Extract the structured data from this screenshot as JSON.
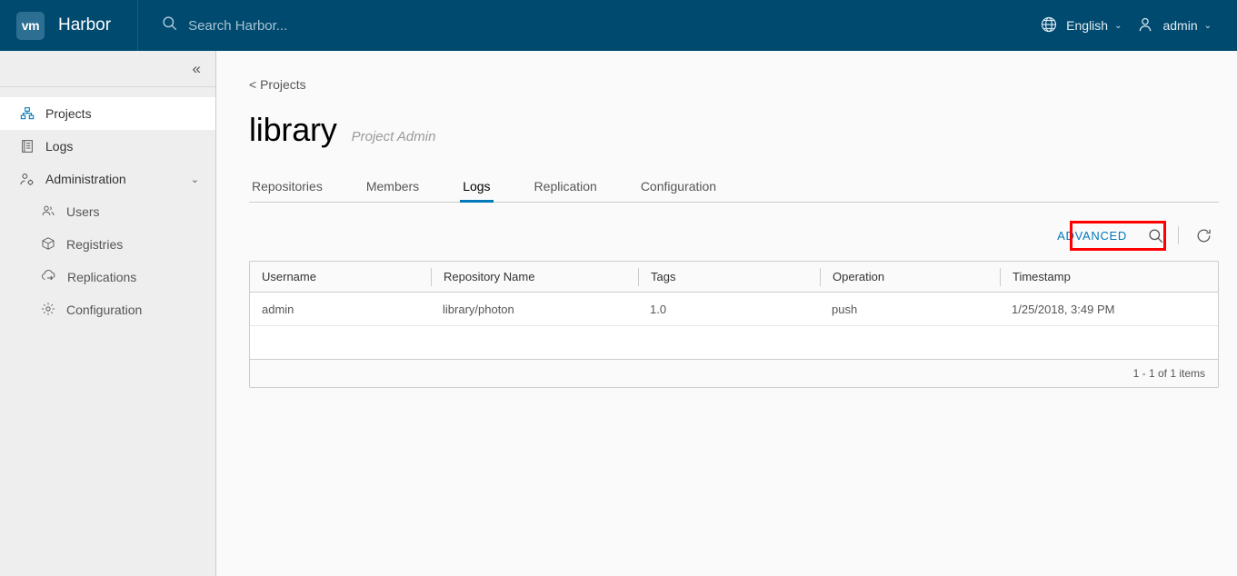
{
  "header": {
    "logo_text": "vm",
    "brand": "Harbor",
    "search": {
      "placeholder": "Search Harbor...",
      "value": "",
      "icon": "search-icon"
    },
    "language": {
      "label": "English",
      "icon": "globe-icon",
      "caret": "⌄"
    },
    "user": {
      "label": "admin",
      "icon": "user-icon",
      "caret": "⌄"
    }
  },
  "sidebar": {
    "collapse_icon": "«",
    "items": [
      {
        "label": "Projects",
        "icon": "projects-icon",
        "active": true
      },
      {
        "label": "Logs",
        "icon": "logs-icon",
        "active": false
      },
      {
        "label": "Administration",
        "icon": "administration-icon",
        "active": false,
        "chevron": "⌄"
      }
    ],
    "sub_items": [
      {
        "label": "Users",
        "icon": "users-icon"
      },
      {
        "label": "Registries",
        "icon": "registries-icon"
      },
      {
        "label": "Replications",
        "icon": "replications-icon"
      },
      {
        "label": "Configuration",
        "icon": "configuration-icon"
      }
    ]
  },
  "main": {
    "breadcrumb": "< Projects",
    "title": "library",
    "subtitle": "Project Admin",
    "tabs": [
      {
        "label": "Repositories",
        "active": false
      },
      {
        "label": "Members",
        "active": false
      },
      {
        "label": "Logs",
        "active": true
      },
      {
        "label": "Replication",
        "active": false
      },
      {
        "label": "Configuration",
        "active": false
      }
    ],
    "toolbar": {
      "advanced_label": "ADVANCED",
      "search_icon": "search-icon",
      "refresh_icon": "refresh-icon"
    },
    "table": {
      "columns": [
        "Username",
        "Repository Name",
        "Tags",
        "Operation",
        "Timestamp"
      ],
      "rows": [
        {
          "username": "admin",
          "repository_name": "library/photon",
          "tags": "1.0",
          "operation": "push",
          "timestamp": "1/25/2018, 3:49 PM"
        }
      ],
      "footer": "1 - 1 of 1 items"
    }
  },
  "colors": {
    "header_bg": "#004a70",
    "accent": "#0079b8",
    "sidebar_bg": "#eeeeee",
    "content_bg": "#fafafa",
    "annotation": "#ff0000"
  }
}
